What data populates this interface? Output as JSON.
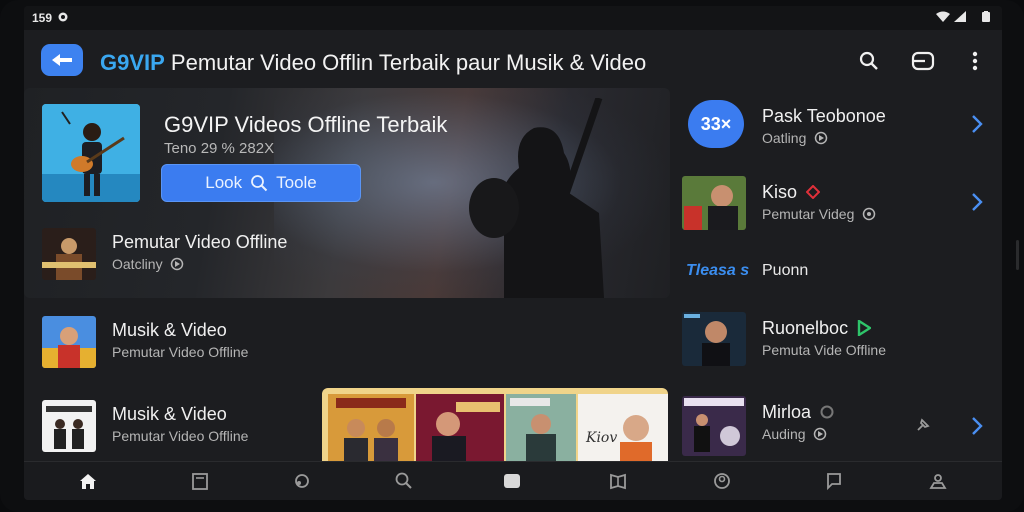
{
  "status": {
    "time": "159"
  },
  "app": {
    "brand": "G9VIP",
    "title_rest": " Pemutar Video Offlin Terbaik paur Musik & Video"
  },
  "hero": {
    "title": "G9VIP Videos Offline Terbaik",
    "subtitle": "Teno 29 % 282X",
    "button_left": "Look",
    "button_right": "Toole"
  },
  "left_list": [
    {
      "title": "Pemutar Video Offline",
      "subtitle": "Oatcliny"
    },
    {
      "title": "Musik & Video",
      "subtitle": "Pemutar Video Offline"
    },
    {
      "title": "Musik & Video",
      "subtitle": "Pemutar Video Offline"
    }
  ],
  "right_list": [
    {
      "title": "Pask Teobonoe",
      "subtitle": "Oatling",
      "badge_text": "33×"
    },
    {
      "title": "Kiso",
      "subtitle": "Pemutar Videg"
    },
    {
      "label": "Tleasa s",
      "title": "Puonn"
    },
    {
      "title": "Ruonelboc",
      "subtitle": "Pemuta Vide Offline"
    },
    {
      "title": "Mirloa",
      "subtitle": "Auding"
    }
  ],
  "colors": {
    "accent": "#3b7cf0",
    "brand": "#3aa7f0",
    "background": "#1c1d20"
  },
  "icons": {
    "appbar": [
      "search-icon",
      "cast-icon",
      "more-vert-icon"
    ],
    "nav": [
      "home-icon",
      "library-icon",
      "globe-icon",
      "search-icon",
      "folder-icon",
      "book-icon",
      "explore-icon",
      "chat-icon",
      "profile-icon"
    ]
  }
}
